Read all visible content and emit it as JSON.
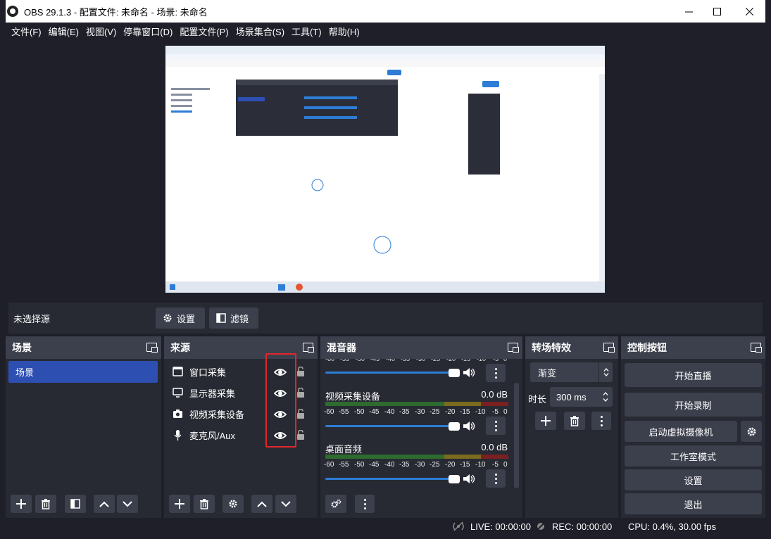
{
  "window": {
    "title": "OBS 29.1.3 - 配置文件: 未命名 - 场景: 未命名"
  },
  "menu": [
    "文件(F)",
    "编辑(E)",
    "视图(V)",
    "停靠窗口(D)",
    "配置文件(P)",
    "场景集合(S)",
    "工具(T)",
    "帮助(H)"
  ],
  "source_bar": {
    "no_selection": "未选择源",
    "settings_label": "设置",
    "filters_label": "滤镜"
  },
  "scenes": {
    "title": "场景",
    "items": [
      "场景"
    ]
  },
  "sources": {
    "title": "来源",
    "items": [
      {
        "name": "窗口采集",
        "icon": "window-icon"
      },
      {
        "name": "显示器采集",
        "icon": "monitor-icon"
      },
      {
        "name": "视频采集设备",
        "icon": "camera-icon"
      },
      {
        "name": "麦克风/Aux",
        "icon": "mic-icon"
      }
    ]
  },
  "mixer": {
    "title": "混音器",
    "ticks": [
      "-60",
      "-55",
      "-50",
      "-45",
      "-40",
      "-35",
      "-30",
      "-25",
      "-20",
      "-15",
      "-10",
      "-5",
      "0"
    ],
    "channels": [
      {
        "name": "视频采集设备",
        "db": "0.0 dB"
      },
      {
        "name": "桌面音频",
        "db": "0.0 dB"
      }
    ]
  },
  "transitions": {
    "title": "转场特效",
    "selected": "渐变",
    "duration_label": "时长",
    "duration_value": "300 ms"
  },
  "controls": {
    "title": "控制按钮",
    "start_stream": "开始直播",
    "start_record": "开始录制",
    "virtual_cam": "启动虚拟摄像机",
    "studio_mode": "工作室模式",
    "settings": "设置",
    "exit": "退出"
  },
  "status": {
    "live": "LIVE: 00:00:00",
    "rec": "REC: 00:00:00",
    "cpu": "CPU: 0.4%, 30.00 fps"
  },
  "colors": {
    "accent": "#2d4fb2",
    "highlight": "#e3252a",
    "slider": "#2d7cd6"
  }
}
